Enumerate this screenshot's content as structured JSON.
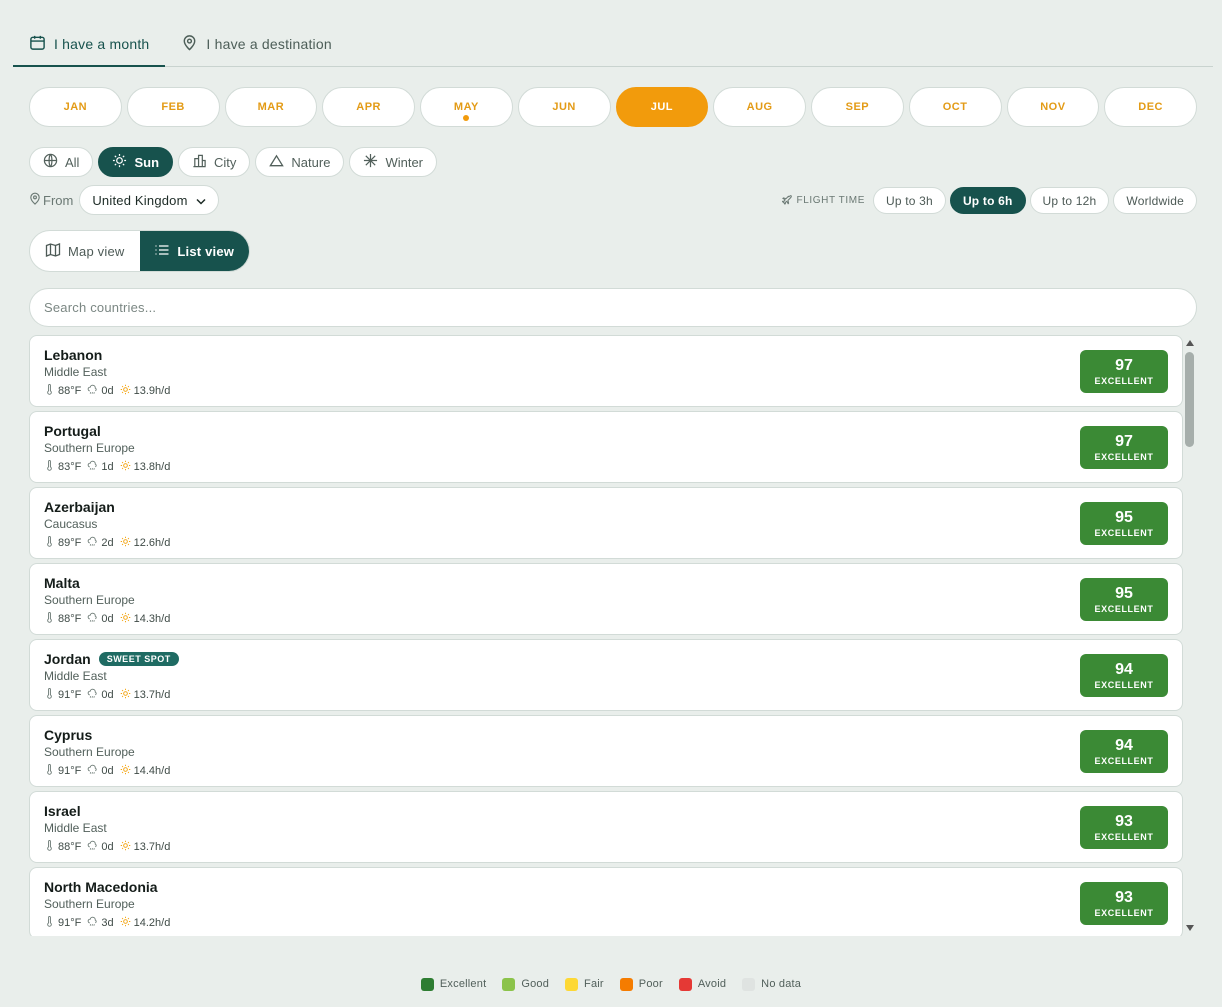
{
  "tabs": [
    {
      "label": "I have a month",
      "icon": "calendar-icon",
      "active": true
    },
    {
      "label": "I have a destination",
      "icon": "map-pin-icon",
      "active": false
    }
  ],
  "months": [
    "JAN",
    "FEB",
    "MAR",
    "APR",
    "MAY",
    "JUN",
    "JUL",
    "AUG",
    "SEP",
    "OCT",
    "NOV",
    "DEC"
  ],
  "selected_month": "JUL",
  "current_month_marker": "MAY",
  "categories": [
    {
      "label": "All",
      "icon": "globe-icon",
      "active": false
    },
    {
      "label": "Sun",
      "icon": "sun-icon",
      "active": true
    },
    {
      "label": "City",
      "icon": "city-icon",
      "active": false
    },
    {
      "label": "Nature",
      "icon": "mountain-icon",
      "active": false
    },
    {
      "label": "Winter",
      "icon": "snowflake-icon",
      "active": false
    }
  ],
  "from": {
    "label": "From",
    "value": "United Kingdom"
  },
  "flight_time": {
    "label": "FLIGHT TIME",
    "options": [
      "Up to 3h",
      "Up to 6h",
      "Up to 12h",
      "Worldwide"
    ],
    "selected": "Up to 6h"
  },
  "views": [
    {
      "label": "Map view",
      "icon": "map-icon",
      "active": false
    },
    {
      "label": "List view",
      "icon": "list-icon",
      "active": true
    }
  ],
  "search": {
    "placeholder": "Search countries..."
  },
  "countries": [
    {
      "name": "Lebanon",
      "region": "Middle East",
      "temp": "88°F",
      "rain": "0d",
      "sun": "13.9h/d",
      "score": "97",
      "rating": "EXCELLENT",
      "badge": ""
    },
    {
      "name": "Portugal",
      "region": "Southern Europe",
      "temp": "83°F",
      "rain": "1d",
      "sun": "13.8h/d",
      "score": "97",
      "rating": "EXCELLENT",
      "badge": ""
    },
    {
      "name": "Azerbaijan",
      "region": "Caucasus",
      "temp": "89°F",
      "rain": "2d",
      "sun": "12.6h/d",
      "score": "95",
      "rating": "EXCELLENT",
      "badge": ""
    },
    {
      "name": "Malta",
      "region": "Southern Europe",
      "temp": "88°F",
      "rain": "0d",
      "sun": "14.3h/d",
      "score": "95",
      "rating": "EXCELLENT",
      "badge": ""
    },
    {
      "name": "Jordan",
      "region": "Middle East",
      "temp": "91°F",
      "rain": "0d",
      "sun": "13.7h/d",
      "score": "94",
      "rating": "EXCELLENT",
      "badge": "SWEET SPOT"
    },
    {
      "name": "Cyprus",
      "region": "Southern Europe",
      "temp": "91°F",
      "rain": "0d",
      "sun": "14.4h/d",
      "score": "94",
      "rating": "EXCELLENT",
      "badge": ""
    },
    {
      "name": "Israel",
      "region": "Middle East",
      "temp": "88°F",
      "rain": "0d",
      "sun": "13.7h/d",
      "score": "93",
      "rating": "EXCELLENT",
      "badge": ""
    },
    {
      "name": "North Macedonia",
      "region": "Southern Europe",
      "temp": "91°F",
      "rain": "3d",
      "sun": "14.2h/d",
      "score": "93",
      "rating": "EXCELLENT",
      "badge": ""
    }
  ],
  "legend": [
    {
      "label": "Excellent",
      "color": "#2e7d32"
    },
    {
      "label": "Good",
      "color": "#8bc34a"
    },
    {
      "label": "Fair",
      "color": "#fdd835"
    },
    {
      "label": "Poor",
      "color": "#f57c00"
    },
    {
      "label": "Avoid",
      "color": "#e53935"
    },
    {
      "label": "No data",
      "color": "#dfe3e1"
    }
  ],
  "colors": {
    "accent": "#17524d",
    "month_active": "#f29b0c",
    "score_excellent": "#3b8a35"
  }
}
